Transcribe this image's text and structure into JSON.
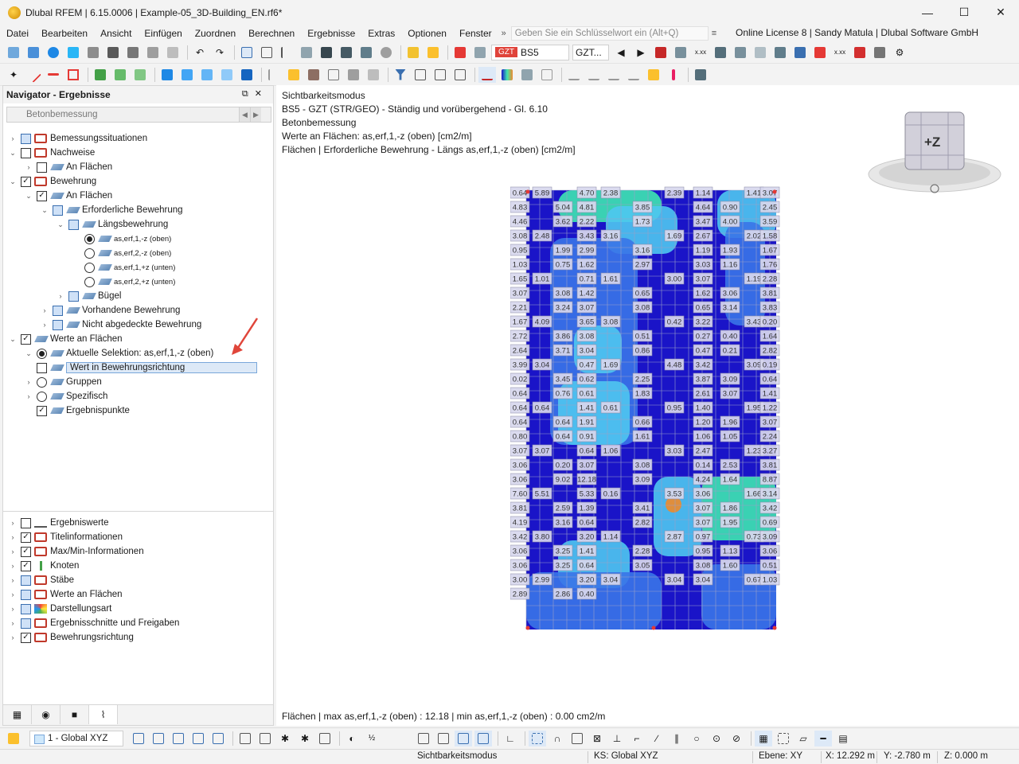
{
  "window": {
    "title": "Dlubal RFEM | 6.15.0006 | Example-05_3D-Building_EN.rf6*",
    "minimize": "—",
    "maximize": "☐",
    "close": "✕"
  },
  "menu": {
    "items": [
      "Datei",
      "Bearbeiten",
      "Ansicht",
      "Einfügen",
      "Zuordnen",
      "Berechnen",
      "Ergebnisse",
      "Extras",
      "Optionen",
      "Fenster"
    ],
    "more": "»",
    "search_placeholder": "Geben Sie ein Schlüsselwort ein (Alt+Q)",
    "license": "Online License 8 | Sandy Matula | Dlubal Software GmbH"
  },
  "toolbar": {
    "load_badge": "GZT",
    "load_combo": "BS5",
    "result_combo": "GZT...",
    "xxx_label": "x.xx"
  },
  "navigator": {
    "title": "Navigator - Ergebnisse",
    "module_combo": "Betonbemessung",
    "items": [
      {
        "label": "Bemessungssituationen"
      },
      {
        "label": "Nachweise"
      },
      {
        "label": "An Flächen"
      },
      {
        "label": "Bewehrung"
      },
      {
        "label": "An Flächen"
      },
      {
        "label": "Erforderliche Bewehrung"
      },
      {
        "label": "Längsbewehrung"
      },
      {
        "label": "as,erf,1,-z (oben)"
      },
      {
        "label": "as,erf,2,-z (oben)"
      },
      {
        "label": "as,erf,1,+z (unten)"
      },
      {
        "label": "as,erf,2,+z (unten)"
      },
      {
        "label": "Bügel"
      },
      {
        "label": "Vorhandene Bewehrung"
      },
      {
        "label": "Nicht abgedeckte Bewehrung"
      },
      {
        "label": "Werte an Flächen"
      },
      {
        "label": "Aktuelle Selektion: as,erf,1,-z (oben)"
      },
      {
        "label": "Wert in Bewehrungsrichtung"
      },
      {
        "label": "Gruppen"
      },
      {
        "label": "Spezifisch"
      },
      {
        "label": "Ergebnispunkte"
      },
      {
        "label": "Ergebniswerte"
      },
      {
        "label": "Titelinformationen"
      },
      {
        "label": "Max/Min-Informationen"
      },
      {
        "label": "Knoten"
      },
      {
        "label": "Stäbe"
      },
      {
        "label": "Werte an Flächen"
      },
      {
        "label": "Darstellungsart"
      },
      {
        "label": "Ergebnisschnitte und Freigaben"
      },
      {
        "label": "Bewehrungsrichtung"
      }
    ]
  },
  "view": {
    "info": [
      "Sichtbarkeitsmodus",
      "BS5 - GZT (STR/GEO) - Ständig und vorübergehend - Gl. 6.10",
      "Betonbemessung",
      "Werte an Flächen: as,erf,1,-z (oben) [cm2/m]",
      "Flächen | Erforderliche Bewehrung - Längs as,erf,1,-z (oben) [cm2/m]"
    ],
    "summary": "Flächen | max as,erf,1,-z (oben) : 12.18 | min as,erf,1,-z (oben) : 0.00 cm2/m",
    "viewcube_label": "+Z",
    "colors": {
      "base": "#1a14c8",
      "mid": "#3a74e8",
      "light": "#4fc6f0",
      "high": "#3ee5b0",
      "hot": "#f08a2a"
    },
    "values": [
      "0.64",
      "5.89",
      "4.70",
      "2.38",
      "2.39",
      "1.14",
      "1.41",
      "3.07",
      "4.83",
      "5.04",
      "4.81",
      "3.85",
      "4.64",
      "0.90",
      "2.45",
      "4.46",
      "3.62",
      "2.22",
      "1.73",
      "3.47",
      "4.00",
      "3.59",
      "3.08",
      "2.48",
      "3.43",
      "3.16",
      "1.69",
      "2.67",
      "2.02",
      "1.58",
      "0.95",
      "1.99",
      "2.99",
      "3.16",
      "1.19",
      "1.93",
      "1.67",
      "1.03",
      "0.75",
      "1.62",
      "2.97",
      "3.03",
      "1.16",
      "1.76",
      "1.65",
      "1.01",
      "0.71",
      "1.61",
      "3.00",
      "3.07",
      "1.19",
      "2.28",
      "3.07",
      "3.08",
      "1.42",
      "0.65",
      "1.62",
      "3.06",
      "3.81",
      "2.21",
      "3.24",
      "3.07",
      "3.08",
      "0.65",
      "3.14",
      "3.83",
      "1.67",
      "4.09",
      "3.65",
      "3.08",
      "0.42",
      "3.22",
      "3.43",
      "0.20",
      "2.72",
      "3.86",
      "3.08",
      "0.51",
      "0.27",
      "0.40",
      "1.64",
      "2.64",
      "3.71",
      "3.04",
      "0.86",
      "0.47",
      "0.21",
      "2.82",
      "3.99",
      "3.04",
      "0.47",
      "1.69",
      "4.48",
      "3.42",
      "3.09",
      "0.19",
      "0.02",
      "3.45",
      "0.62",
      "2.25",
      "3.87",
      "3.09",
      "0.64",
      "0.64",
      "0.76",
      "0.61",
      "1.83",
      "2.61",
      "3.07",
      "1.41",
      "0.64",
      "0.64",
      "1.41",
      "0.61",
      "0.95",
      "1.40",
      "1.95",
      "1.22",
      "0.64",
      "0.64",
      "1.91",
      "0.66",
      "1.20",
      "1.96",
      "3.07",
      "0.80",
      "0.64",
      "0.91",
      "1.61",
      "1.06",
      "1.05",
      "2.24",
      "3.07",
      "3.07",
      "0.64",
      "1.06",
      "3.03",
      "2.47",
      "1.23",
      "3.27",
      "3.06",
      "0.20",
      "3.07",
      "3.08",
      "0.14",
      "2.53",
      "3.81",
      "3.06",
      "9.02",
      "12.18",
      "3.09",
      "4.24",
      "1.64",
      "8.87",
      "7.60",
      "5.51",
      "5.33",
      "0.16",
      "3.53",
      "3.06",
      "1.66",
      "3.14",
      "3.81",
      "2.59",
      "1.39",
      "3.41",
      "3.07",
      "1.86",
      "3.42",
      "4.19",
      "3.16",
      "0.64",
      "2.82",
      "3.07",
      "1.95",
      "0.69",
      "3.42",
      "3.80",
      "3.20",
      "1.14",
      "2.87",
      "0.97",
      "0.73",
      "3.09",
      "3.06",
      "3.25",
      "1.41",
      "2.28",
      "0.95",
      "1.13",
      "3.06",
      "3.06",
      "3.25",
      "0.64",
      "3.05",
      "3.08",
      "1.60",
      "0.51",
      "3.00",
      "2.99",
      "3.20",
      "3.04",
      "3.04",
      "3.04",
      "0.67",
      "1.03",
      "2.89",
      "2.86",
      "0.40"
    ]
  },
  "bottom": {
    "coord_system": "1 - Global XYZ"
  },
  "status": {
    "mode": "Sichtbarkeitsmodus",
    "ks": "KS: Global XYZ",
    "plane": "Ebene: XY",
    "x": "X: 12.292 m",
    "y": "Y: -2.780 m",
    "z": "Z: 0.000 m"
  }
}
